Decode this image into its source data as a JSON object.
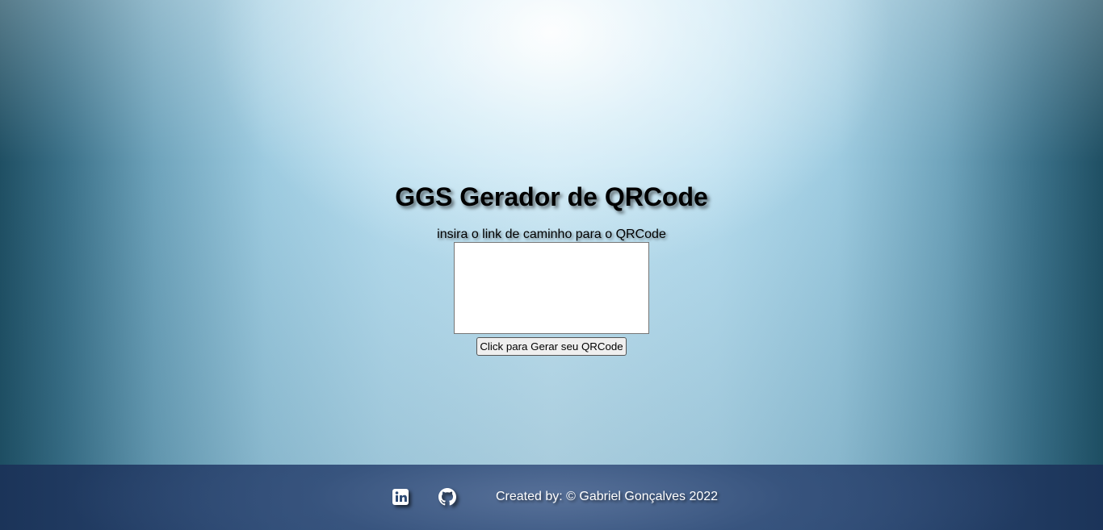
{
  "main": {
    "title": "GGS Gerador de QRCode",
    "input_label": "insira o link de caminho para o QRCode",
    "input_value": "",
    "button_label": "Click para Gerar seu QRCode"
  },
  "footer": {
    "icons": [
      "linkedin-icon",
      "github-icon"
    ],
    "credit": "Created by: © Gabriel Gonçalves 2022"
  },
  "colors": {
    "footer_bg": "#2d4a74",
    "background_center": "#c3e4f3",
    "background_edge": "#1f4f63"
  }
}
